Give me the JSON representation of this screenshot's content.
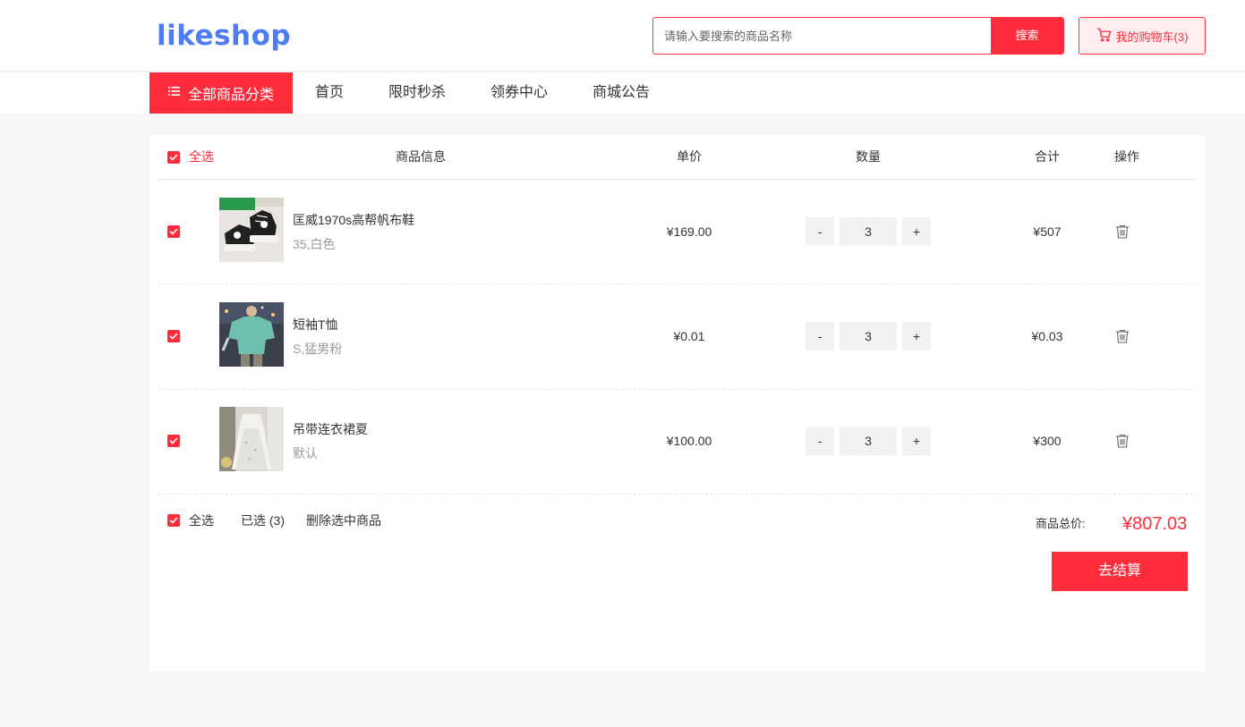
{
  "header": {
    "logo": "likeshop",
    "search": {
      "placeholder": "请输入要搜索的商品名称",
      "button_label": "搜索"
    },
    "cart_label": "我的购物车(3)"
  },
  "nav": {
    "category_label": "全部商品分类",
    "items": [
      {
        "label": "首页"
      },
      {
        "label": "限时秒杀"
      },
      {
        "label": "领券中心"
      },
      {
        "label": "商城公告"
      }
    ]
  },
  "cart": {
    "headers": {
      "select_all": "全选",
      "product_info": "商品信息",
      "unit_price": "单价",
      "quantity": "数量",
      "subtotal": "合计",
      "action": "操作"
    },
    "items": [
      {
        "name": "匡威1970s高帮帆布鞋",
        "spec": "35,白色",
        "price": "¥169.00",
        "qty": "3",
        "subtotal": "¥507",
        "checked": true,
        "image": "sneaker-photo"
      },
      {
        "name": "短袖T恤",
        "spec": "S,猛男粉",
        "price": "¥0.01",
        "qty": "3",
        "subtotal": "¥0.03",
        "checked": true,
        "image": "tshirt-photo"
      },
      {
        "name": "吊带连衣裙夏",
        "spec": "默认",
        "price": "¥100.00",
        "qty": "3",
        "subtotal": "¥300",
        "checked": true,
        "image": "dress-photo"
      }
    ],
    "qty_minus": "-",
    "qty_plus": "+",
    "footer": {
      "select_all": "全选",
      "selected_count": "已选 (3)",
      "delete_selected": "删除选中商品",
      "total_label": "商品总价:",
      "total_value": "¥807.03",
      "checkout_label": "去结算"
    }
  },
  "colors": {
    "accent": "#ff2c3c",
    "logo": "#4d7cf4",
    "page_bg": "#f5f6f8"
  }
}
